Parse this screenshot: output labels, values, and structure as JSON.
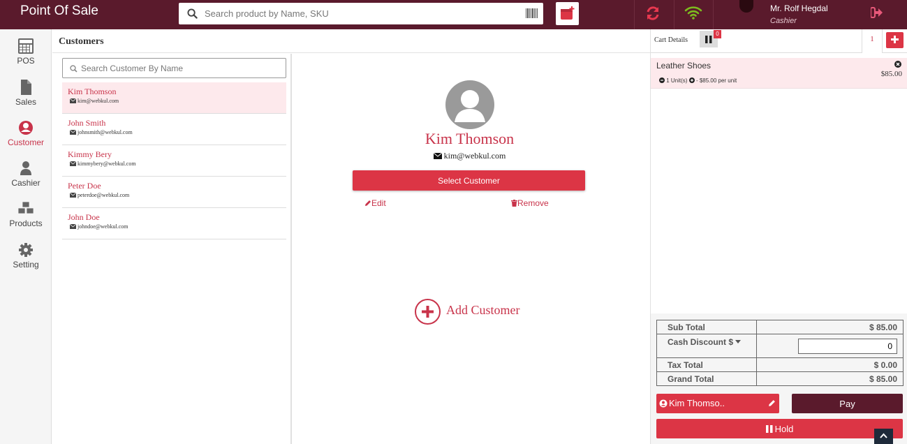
{
  "app": {
    "title": "Point Of Sale"
  },
  "search": {
    "placeholder": "Search product by Name, SKU"
  },
  "user": {
    "name": "Mr. Rolf Hegdal",
    "role": "Cashier"
  },
  "sidebar": {
    "items": [
      {
        "label": "POS",
        "icon": "calculator-icon"
      },
      {
        "label": "Sales",
        "icon": "document-icon"
      },
      {
        "label": "Customer",
        "icon": "user-circle-icon",
        "active": true
      },
      {
        "label": "Cashier",
        "icon": "user-icon"
      },
      {
        "label": "Products",
        "icon": "cubes-icon"
      },
      {
        "label": "Setting",
        "icon": "gear-icon"
      }
    ]
  },
  "customers": {
    "heading": "Customers",
    "search_placeholder": "Search Customer By Name",
    "list": [
      {
        "name": "Kim Thomson",
        "email": "kim@webkul.com"
      },
      {
        "name": "John Smith",
        "email": "johnsmith@webkul.com"
      },
      {
        "name": "Kimmy Bery",
        "email": "kimmybery@webkul.com"
      },
      {
        "name": "Peter Doe",
        "email": "peterdoe@webkul.com"
      },
      {
        "name": "John Doe",
        "email": "johndoe@webkul.com"
      }
    ],
    "selected": {
      "name": "Kim Thomson",
      "email": "kim@webkul.com",
      "select_label": "Select Customer",
      "edit_label": "Edit",
      "remove_label": "Remove"
    },
    "add_label": "Add Customer"
  },
  "cart": {
    "details_label": "Cart Details",
    "hold_count": "0",
    "active_tab": "1",
    "items": [
      {
        "name": "Leather Shoes",
        "price": "$85.00",
        "qty": "1 Unit(s)",
        "unit_price": "- $85.00 per unit"
      }
    ],
    "totals": {
      "sub_total_label": "Sub Total",
      "sub_total": "$ 85.00",
      "discount_label": "Cash Discount $",
      "discount_value": "0",
      "tax_label": "Tax Total",
      "tax": "$ 0.00",
      "grand_label": "Grand Total",
      "grand": "$ 85.00"
    },
    "customer_button": "Kim Thomso..",
    "pay_label": "Pay",
    "hold_label": "Hold"
  },
  "colors": {
    "brand": "#5a1a2c",
    "accent": "#dc3545",
    "active_row": "#fde9ec"
  }
}
